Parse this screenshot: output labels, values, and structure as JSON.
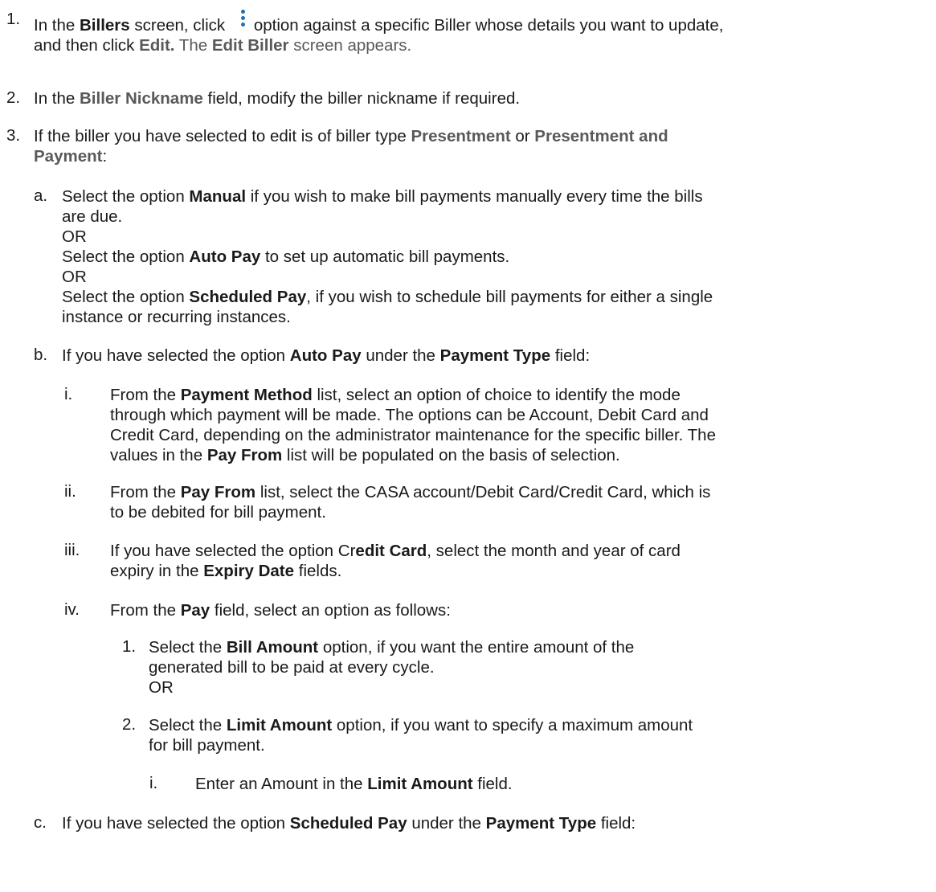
{
  "steps": [
    {
      "num": "1.",
      "pre": "In the ",
      "billers": "Billers",
      "mid": " screen, click ",
      "post": "option against a specific Biller whose details you want to update,",
      "line2_pre": "and then click ",
      "edit": "Edit.",
      "line2_mid": " The ",
      "edit_biller": "Edit Biller",
      "line2_post": " screen appears.",
      "icon": "kebab-menu-icon",
      "icon_color": "#1f6fb5"
    },
    {
      "num": "2.",
      "pre": "In the ",
      "bold": "Biller Nickname",
      "post": " field, modify the biller nickname if required."
    },
    {
      "num": "3.",
      "pre": "If the biller you have selected to edit is of biller type ",
      "bold1": "Presentment",
      "mid": " or ",
      "bold2": "Presentment and",
      "bold3": "Payment",
      "post": ":"
    }
  ],
  "sub_a": {
    "label": "a.",
    "l1_pre": "Select the option ",
    "manual": "Manual",
    "l1_post": " if you wish to make bill payments manually every time the bills",
    "l2": "are due.",
    "or1": "OR",
    "l4_pre": "Select the option ",
    "auto_pay": "Auto Pay",
    "l4_post": " to set up automatic bill payments.",
    "or2": "OR",
    "l6_pre": "Select the option ",
    "scheduled_pay": "Scheduled Pay",
    "l6_post": ", if you wish to schedule bill payments for either a single",
    "l7": "instance or recurring instances."
  },
  "sub_b": {
    "label": "b.",
    "pre": "If you have selected the option ",
    "auto_pay": "Auto Pay",
    "mid": " under the ",
    "payment_type": "Payment Type",
    "post": " field:"
  },
  "roman_i": {
    "label": "i.",
    "l1_pre": "From the ",
    "payment_method": "Payment Method",
    "l1_post": " list, select an option of choice to identify the mode",
    "l2": "through which payment will be made. The options can be Account, Debit Card and",
    "l3": "Credit Card, depending on the administrator maintenance for the specific biller.  The",
    "l4_pre": "values in the ",
    "pay_from": "Pay From",
    "l4_post": " list will be populated on the basis of selection."
  },
  "roman_ii": {
    "label": "ii.",
    "l1_pre": "From the ",
    "pay_from": "Pay From",
    "l1_post": " list, select the CASA account/Debit Card/Credit Card, which is",
    "l2": "to be debited for bill payment."
  },
  "roman_iii": {
    "label": "iii.",
    "l1_pre": "If you have selected the option Cr",
    "edit_card": "edit Card",
    "l1_post": ", select the month and year of card",
    "l2_pre": "expiry in the ",
    "expiry_date": "Expiry Date",
    "l2_post": " fields."
  },
  "roman_iv": {
    "label": "iv.",
    "pre": "From the ",
    "pay": "Pay",
    "post": " field, select an option as follows:"
  },
  "num_1": {
    "label": "1.",
    "l1_pre": "Select the ",
    "bill_amount": "Bill Amount",
    "l1_post": " option, if you want the entire amount of the",
    "l2": "generated bill to be paid at every cycle.",
    "or": "OR"
  },
  "num_2": {
    "label": "2.",
    "l1_pre": "Select the ",
    "limit_amount": "Limit Amount",
    "l1_post": " option, if you want to specify a maximum amount",
    "l2": "for bill payment."
  },
  "deep_i": {
    "label": "i.",
    "pre": "Enter an Amount in the ",
    "limit_amount": "Limit Amount",
    "post": " field."
  },
  "sub_c": {
    "label": "c.",
    "pre": "If you have selected the option ",
    "scheduled_pay": "Scheduled Pay",
    "mid": " under the ",
    "payment_type": "Payment Type",
    "post": " field:"
  }
}
